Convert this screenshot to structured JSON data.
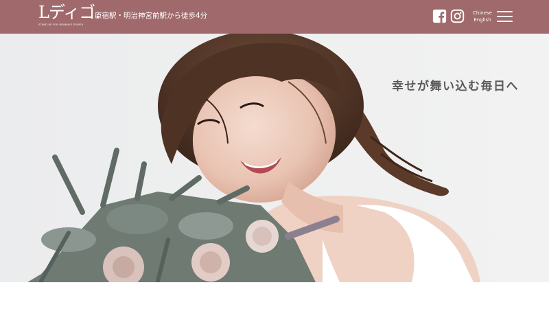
{
  "header": {
    "logo_text": "Lディゴ.",
    "logo_tagline": "STAND UP FOR WOMAN'S POWER",
    "access_text": "原宿駅・明治神宮前駅から徒歩4分",
    "background_color": "#a0696b",
    "social": [
      {
        "icon": "facebook-icon"
      },
      {
        "icon": "instagram-icon"
      }
    ],
    "languages": [
      "Chinese",
      "English"
    ],
    "menu_icon": "hamburger-menu-icon"
  },
  "hero": {
    "tagline": "幸せが舞い込む毎日へ"
  }
}
